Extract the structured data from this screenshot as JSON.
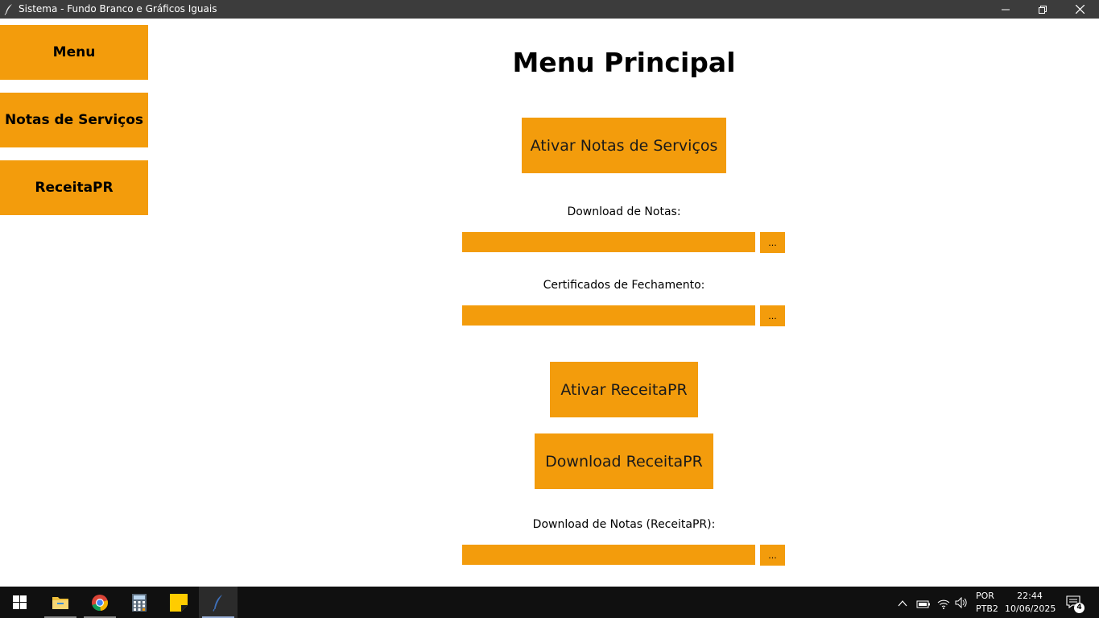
{
  "window": {
    "title": "Sistema - Fundo Branco e Gráficos Iguais",
    "icon": "feather-icon"
  },
  "sidebar": {
    "items": [
      {
        "label": "Menu"
      },
      {
        "label": "Notas de Serviços"
      },
      {
        "label": "ReceitaPR"
      }
    ]
  },
  "main": {
    "title": "Menu Principal",
    "ativar_notas_label": "Ativar Notas de Serviços",
    "download_notas_label": "Download de Notas:",
    "download_notas_value": "",
    "certificados_label": "Certificados de Fechamento:",
    "certificados_value": "",
    "ativar_receita_label": "Ativar ReceitaPR",
    "download_receita_label": "Download ReceitaPR",
    "download_notas_receita_label": "Download de Notas (ReceitaPR):",
    "download_notas_receita_value": "",
    "browse_label": "..."
  },
  "taskbar": {
    "language": "POR",
    "keyboard": "PTB2",
    "time": "22:44",
    "date": "10/06/2025",
    "notifications": "4"
  },
  "colors": {
    "accent": "#f39c0c",
    "titlebar": "#3c3c3c",
    "taskbar": "#101010"
  }
}
